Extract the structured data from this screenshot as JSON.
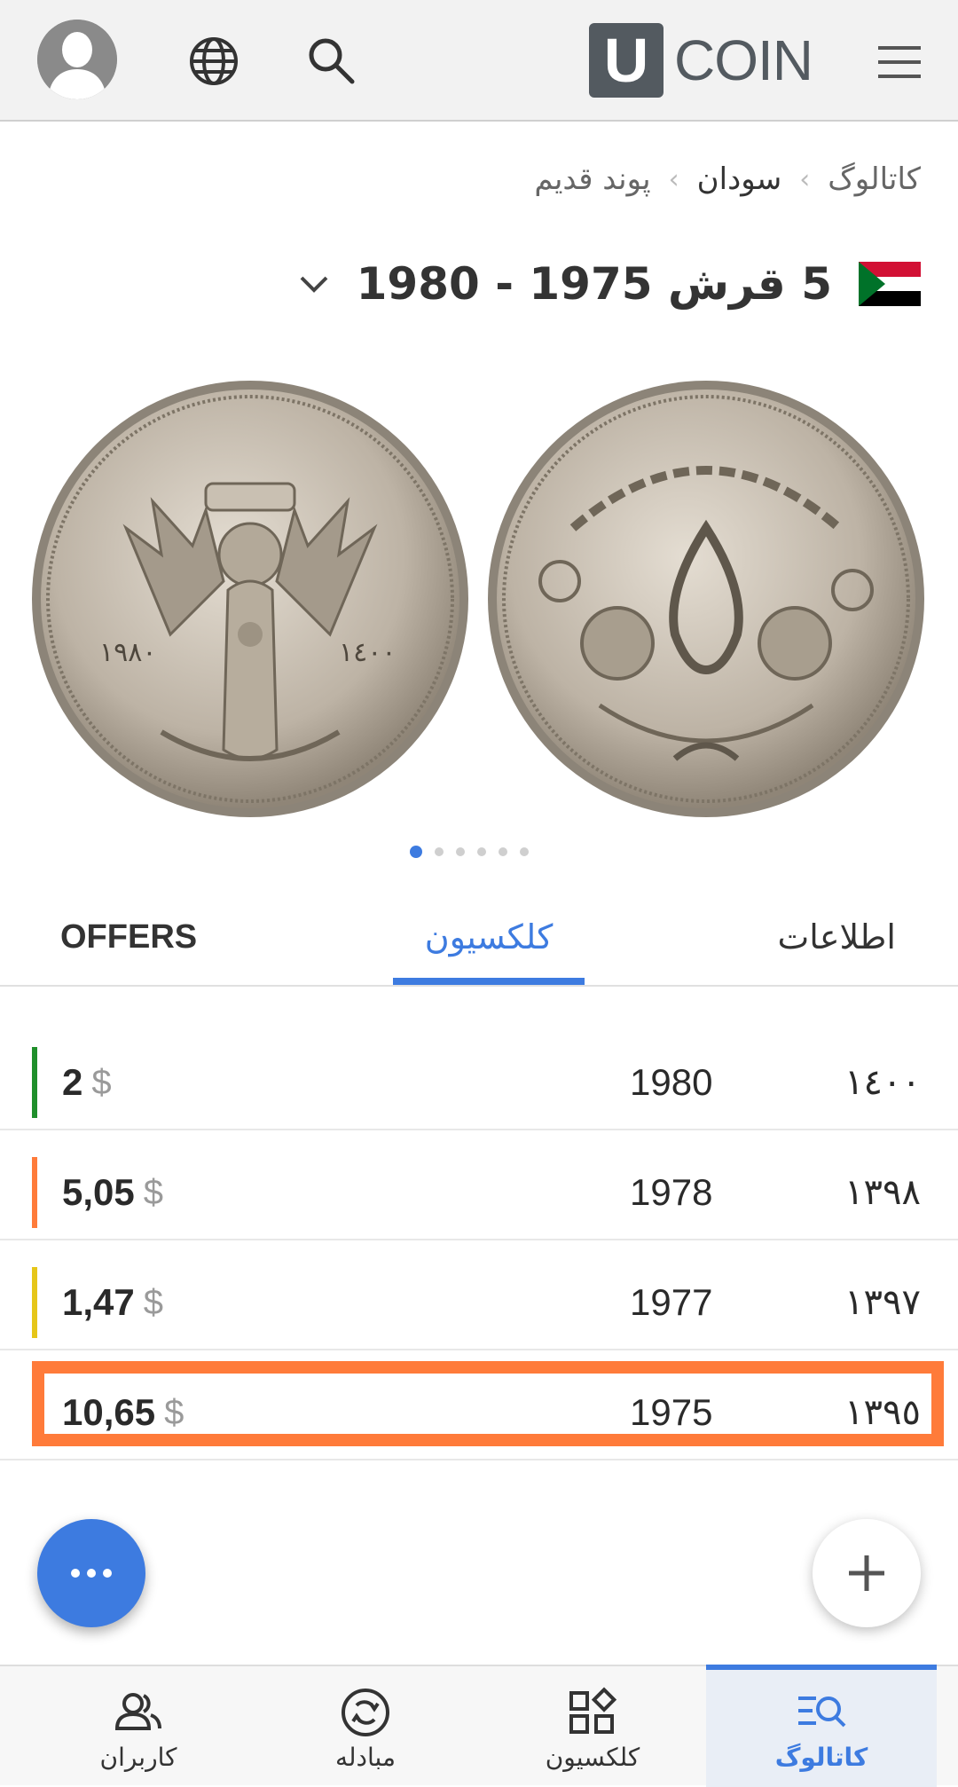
{
  "header": {
    "logo_letter": "U",
    "logo_text": "COIN",
    "icons": [
      "avatar-icon",
      "globe-icon",
      "search-icon",
      "menu-icon"
    ]
  },
  "breadcrumb": {
    "items": [
      "کاتالوگ",
      "سودان",
      "پوند قدیم"
    ]
  },
  "title": {
    "text": "5 قرش 1975 - 1980",
    "flag": "sudan-flag"
  },
  "gallery": {
    "total": 6,
    "active_index": 0
  },
  "tabs": {
    "offers": "OFFERS",
    "collection": "کلکسیون",
    "info": "اطلاعات",
    "active": "collection"
  },
  "rows": [
    {
      "price": "2",
      "currency": "$",
      "year": "1980",
      "arabic_year": "١٤٠٠",
      "color": "#1f8f2b",
      "highlighted": false
    },
    {
      "price": "5,05",
      "currency": "$",
      "year": "1978",
      "arabic_year": "١٣٩٨",
      "color": "#ff7b3a",
      "highlighted": false
    },
    {
      "price": "1,47",
      "currency": "$",
      "year": "1977",
      "arabic_year": "١٣٩٧",
      "color": "#e6c619",
      "highlighted": false
    },
    {
      "price": "10,65",
      "currency": "$",
      "year": "1975",
      "arabic_year": "١٣٩٥",
      "color": "#ff7b3a",
      "highlighted": true
    }
  ],
  "bottom_nav": {
    "users": "کاربران",
    "exchange": "مبادله",
    "collection": "کلکسیون",
    "catalog": "کاتالوگ",
    "active": "catalog"
  },
  "colors": {
    "accent": "#3d7be0",
    "highlight": "#ff7b3a"
  }
}
